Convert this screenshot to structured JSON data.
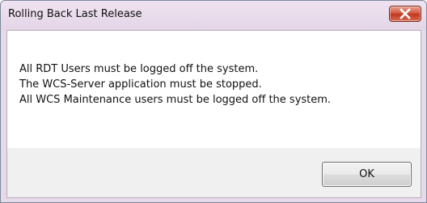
{
  "window": {
    "title": "Rolling Back Last Release",
    "close_icon": "close-icon"
  },
  "message": {
    "lines": [
      "All RDT Users must be logged off the system.",
      "The WCS-Server application must be stopped.",
      "All WCS Maintenance users must be logged off the system."
    ]
  },
  "buttons": {
    "ok_label": "OK"
  },
  "colors": {
    "titlebar": "#e6d9e9",
    "close_button": "#c7432b",
    "button_area": "#f0f0f0"
  }
}
